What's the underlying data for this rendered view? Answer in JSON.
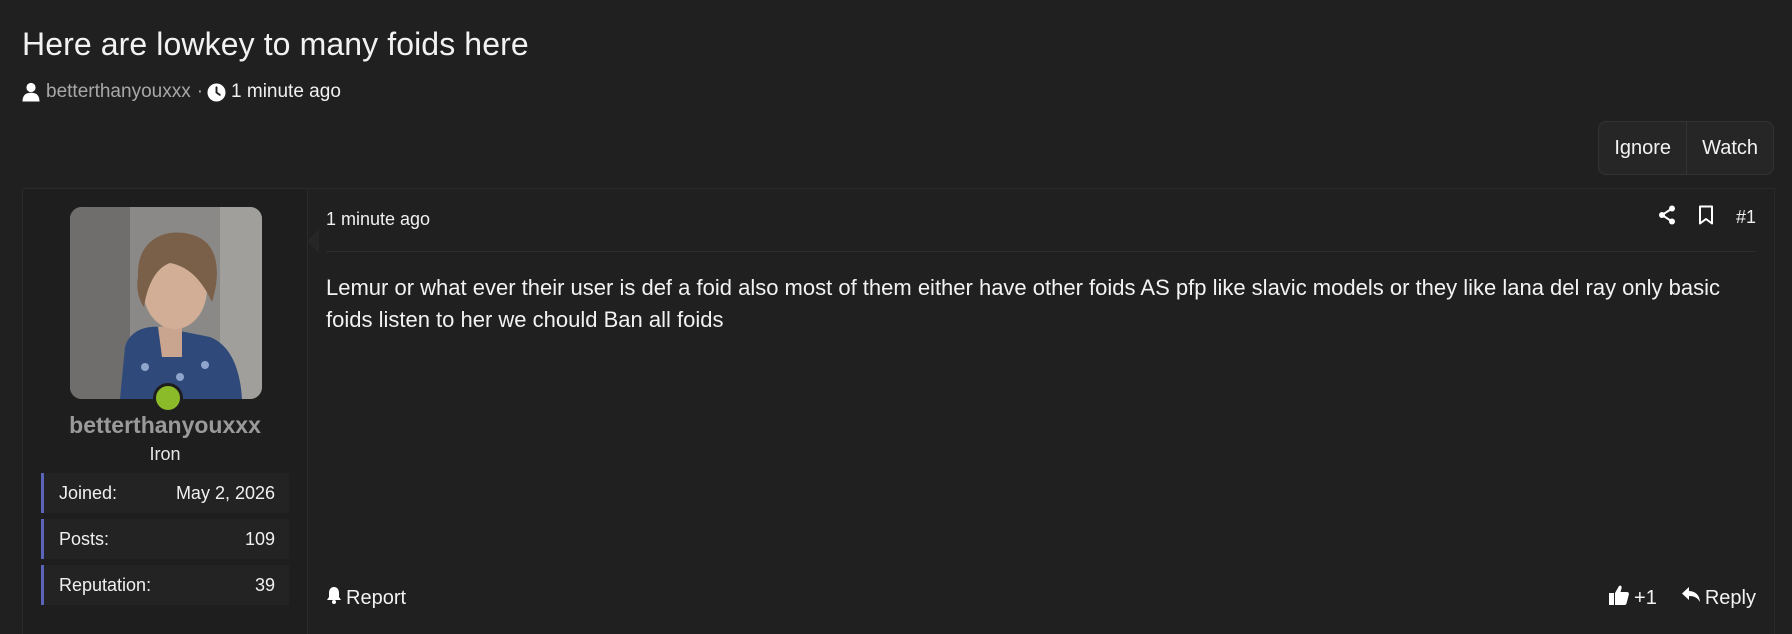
{
  "thread": {
    "title": "Here are lowkey to many foids here",
    "author": "betterthanyouxxx",
    "separator": "·",
    "time": "1 minute ago"
  },
  "actions": {
    "ignore_label": "Ignore",
    "watch_label": "Watch"
  },
  "post": {
    "user": {
      "name": "betterthanyouxxx",
      "rank": "Iron",
      "online_color": "#8cbb2a",
      "stats": [
        {
          "label": "Joined:",
          "value": "May 2, 2026"
        },
        {
          "label": "Posts:",
          "value": "109"
        },
        {
          "label": "Reputation:",
          "value": "39"
        }
      ]
    },
    "date": "1 minute ago",
    "number": "#1",
    "body": "Lemur or what ever their user is def a foid also most of them either have other foids AS pfp like slavic models or they like lana del ray only basic foids listen to her we chould Ban all foids",
    "footer": {
      "report_label": "Report",
      "reaction_count": "+1",
      "reply_label": "Reply"
    }
  },
  "colors": {
    "background": "#202020",
    "stat_accent": "#5a64b8",
    "muted_text": "#a8a8a8"
  },
  "icons": [
    "user-icon",
    "clock-icon",
    "share-icon",
    "bookmark-icon",
    "bell-icon",
    "thumbs-up-icon",
    "reply-icon"
  ]
}
